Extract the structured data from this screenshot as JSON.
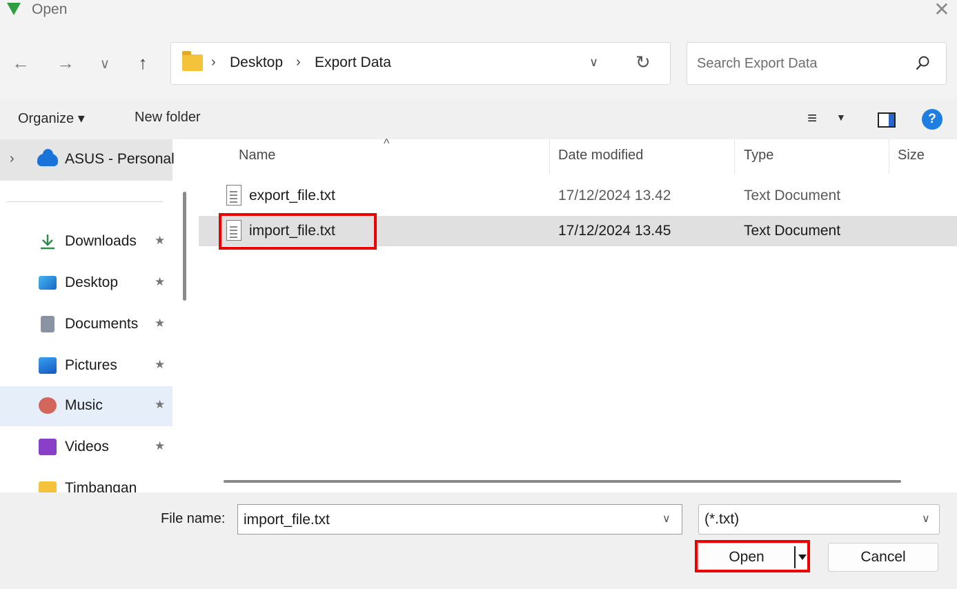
{
  "window": {
    "title": "Open"
  },
  "nav": {
    "back_glyph": "←",
    "forward_glyph": "→",
    "recent_glyph": "∨",
    "up_glyph": "↑"
  },
  "address": {
    "separator": "›",
    "crumbs": [
      "Desktop",
      "Export Data"
    ],
    "dropdown_glyph": "∨",
    "refresh_glyph": "↻"
  },
  "search": {
    "placeholder": "Search Export Data",
    "value": ""
  },
  "toolbar": {
    "organize_label": "Organize ▾",
    "new_folder_label": "New folder",
    "view_glyph": "≡",
    "view_dropdown_glyph": "▼",
    "help_glyph": "?"
  },
  "nav_pane": {
    "top": {
      "chevron": "›",
      "label": "ASUS - Personal"
    },
    "pin_glyph": "★",
    "items": [
      {
        "label": "Downloads",
        "icon": "download-icon"
      },
      {
        "label": "Desktop",
        "icon": "desktop-icon"
      },
      {
        "label": "Documents",
        "icon": "documents-icon"
      },
      {
        "label": "Pictures",
        "icon": "pictures-icon"
      },
      {
        "label": "Music",
        "icon": "music-icon"
      },
      {
        "label": "Videos",
        "icon": "videos-icon"
      },
      {
        "label": "Timbangan",
        "icon": "folder-icon"
      }
    ],
    "selected_index": 4
  },
  "file_list": {
    "sort_glyph": "^",
    "columns": [
      "Name",
      "Date modified",
      "Type",
      "Size"
    ],
    "rows": [
      {
        "name": "export_file.txt",
        "date": "17/12/2024 13.42",
        "type": "Text Document"
      },
      {
        "name": "import_file.txt",
        "date": "17/12/2024 13.45",
        "type": "Text Document"
      }
    ],
    "selected_index": 1
  },
  "bottom": {
    "file_name_label": "File name:",
    "file_name_value": "import_file.txt",
    "file_type_value": "(*.txt)",
    "dropdown_glyph": "∨",
    "open_label": "Open",
    "cancel_label": "Cancel"
  },
  "colors": {
    "highlight": "#ec0000",
    "accent": "#1e7fe0",
    "selected_row": "#e0e0e0"
  }
}
